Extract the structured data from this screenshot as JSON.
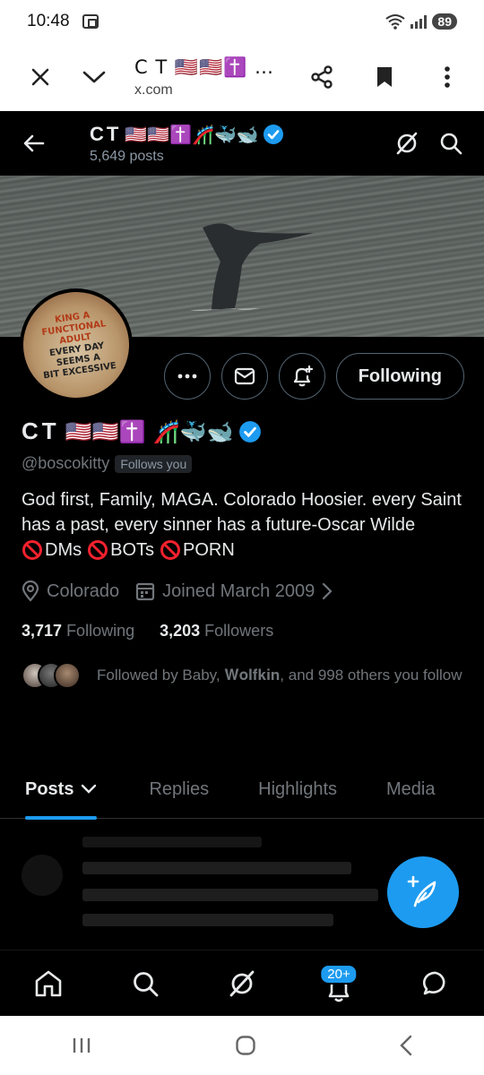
{
  "status": {
    "time": "10:48",
    "battery": "89"
  },
  "browser": {
    "title": "C T 🇺🇸🇺🇸✝️ …",
    "url": "x.com"
  },
  "header": {
    "name": "CT",
    "posts": "5,649 posts"
  },
  "avatar_text": [
    "KING A",
    "FUNCTIONAL",
    "ADULT",
    "EVERY DAY",
    "SEEMS A",
    "BIT EXCESSIVE"
  ],
  "profile": {
    "name": "CT",
    "handle": "@boscokitty",
    "follows_you": "Follows you",
    "bio_line1": "God first, Family, MAGA. Colorado Hoosier. every Saint has a past, every sinner has a future-Oscar Wilde",
    "bio_restrictions": [
      "DMs",
      "BOTs",
      "PORN"
    ],
    "location": "Colorado",
    "joined": "Joined March 2009",
    "following_count": "3,717",
    "following_label": "Following",
    "followers_count": "3,203",
    "followers_label": "Followers",
    "followed_by": "Followed by Baby, 𝐖𝐨𝐥𝐟𝐤𝐢𝐧, and 998 others you follow"
  },
  "actions": {
    "following_label": "Following"
  },
  "tabs": [
    "Posts",
    "Replies",
    "Highlights",
    "Media"
  ],
  "bottom_nav": {
    "notifications_badge": "20+"
  },
  "colors": {
    "accent": "#1d9bf0",
    "background": "#000000",
    "muted": "#71767b",
    "restriction": "#f4212e"
  }
}
